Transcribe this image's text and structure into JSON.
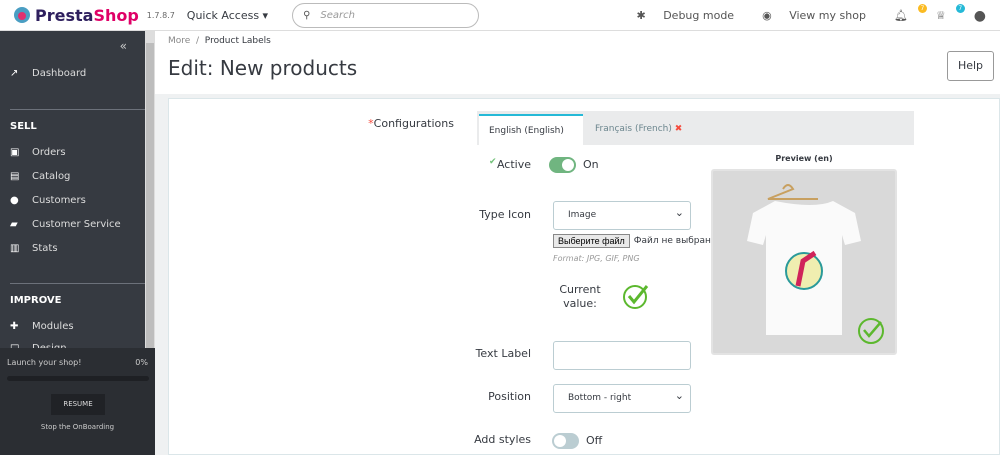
{
  "header": {
    "brand_a": "Presta",
    "brand_b": "Shop",
    "version": "1.7.8.7",
    "quick_access": "Quick Access ▾",
    "search_placeholder": "Search",
    "debug": "Debug mode",
    "view_shop": "View my shop",
    "notif_count": "7",
    "trophy_count": "7"
  },
  "sidebar": {
    "dashboard": "Dashboard",
    "sell": "SELL",
    "items": [
      "Orders",
      "Catalog",
      "Customers",
      "Customer Service",
      "Stats"
    ],
    "improve": "IMPROVE",
    "modules": "Modules",
    "design": "Design"
  },
  "onboarding": {
    "title": "Launch your shop!",
    "progress": "0%",
    "resume": "RESUME",
    "stop": "Stop the OnBoarding"
  },
  "page": {
    "crumb_parent": "More",
    "crumb_current": "Product Labels",
    "title": "Edit: New products",
    "help": "Help"
  },
  "form": {
    "configurations": "Configurations",
    "required_mark": "*",
    "tabs": [
      {
        "label": "English (English)",
        "status": "✔"
      },
      {
        "label": "Français (French)",
        "status": "✖"
      }
    ],
    "active_label": "Active",
    "active_value": "On",
    "type_icon_label": "Type Icon",
    "type_icon_value": "Image",
    "file_button": "Выберите файл",
    "file_status": "Файл не выбран",
    "format_hint": "Format: JPG, GIF, PNG",
    "current_value_label": "Current value:",
    "text_label": "Text Label",
    "text_label_value": "",
    "position_label": "Position",
    "position_value": "Bottom - right",
    "add_styles_label": "Add styles",
    "add_styles_value": "Off",
    "preview_title": "Preview (en)"
  },
  "colors": {
    "accent": "#25b9d7",
    "toggle_on": "#70b580",
    "check": "#72c279",
    "error": "#f54c3e"
  }
}
